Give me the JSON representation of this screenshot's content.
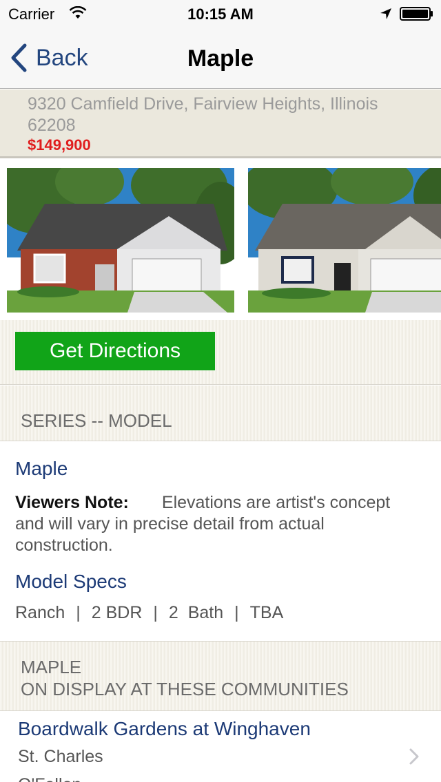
{
  "status_bar": {
    "carrier": "Carrier",
    "time": "10:15 AM",
    "icons": [
      "wifi-icon",
      "location-arrow-icon",
      "battery-icon"
    ]
  },
  "nav": {
    "back_label": "Back",
    "title": "Maple",
    "back_icon": "chevron-left-icon",
    "accent_color": "#23467f"
  },
  "listing": {
    "address": "9320 Camfield Drive, Fairview Heights, Illinois 62208",
    "price": "$149,900",
    "price_color": "#e01e1e"
  },
  "gallery": {
    "photos": [
      "house-elevation-brick",
      "house-elevation-siding"
    ]
  },
  "actions": {
    "directions_label": "Get Directions",
    "directions_color": "#11a418"
  },
  "series_section": {
    "header": "SERIES -- MODEL"
  },
  "model": {
    "name": "Maple",
    "note_label": "Viewers Note:",
    "note_text": "Elevations are artist's concept and will vary in precise detail from actual construction.",
    "specs_heading": "Model Specs",
    "specs": [
      "Ranch",
      "2 BDR",
      "2  Bath",
      "TBA"
    ]
  },
  "communities_section": {
    "header_line1": "MAPLE",
    "header_line2": "ON DISPLAY AT THESE COMMUNITIES"
  },
  "communities": [
    {
      "name": "Boardwalk Gardens at Winghaven",
      "city": "St. Charles",
      "city2": "O'Fallon"
    }
  ]
}
